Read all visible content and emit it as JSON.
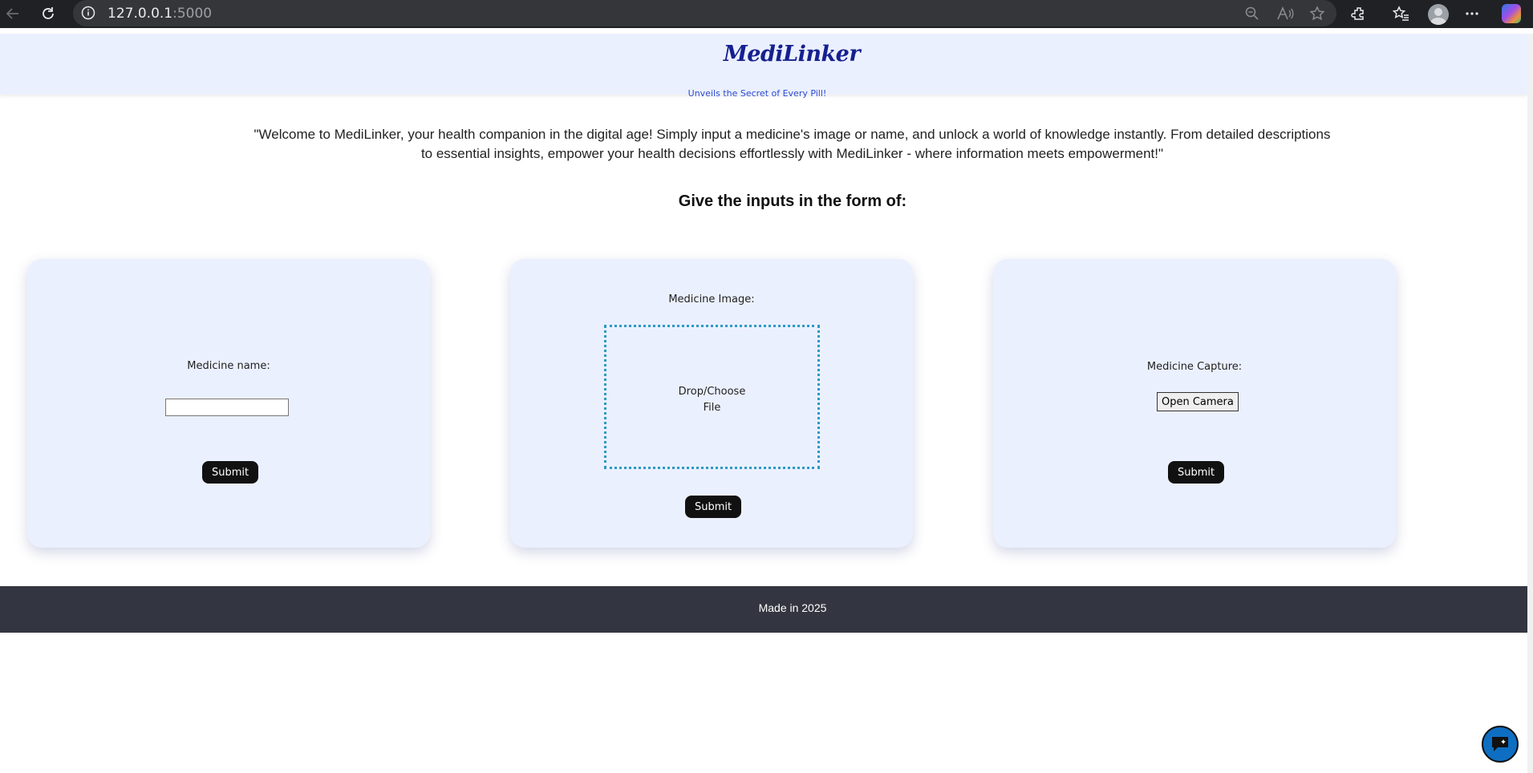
{
  "browser": {
    "url_host": "127.0.0.1",
    "url_port": ":5000"
  },
  "header": {
    "logo": "MediLinker",
    "tagline": "Unveils the Secret of Every Pill!"
  },
  "intro_text": "\"Welcome to MediLinker, your health companion in the digital age! Simply input a medicine's image or name, and unlock a world of knowledge instantly. From detailed descriptions to essential insights, empower your health decisions effortlessly with MediLinker - where information meets empowerment!\"",
  "section_title": "Give the inputs in the form of:",
  "cards": {
    "name": {
      "label": "Medicine name:",
      "input_value": "",
      "submit": "Submit"
    },
    "image": {
      "label": "Medicine Image:",
      "drop_line1": "Drop/Choose",
      "drop_line2": "File",
      "submit": "Submit"
    },
    "capture": {
      "label": "Medicine Capture:",
      "open_camera": "Open Camera",
      "submit": "Submit"
    }
  },
  "footer": {
    "text": "Made in 2025"
  },
  "colors": {
    "accent": "#16208f",
    "card_bg": "#ebf0fe",
    "footer_bg": "#333640",
    "dropzone_border": "#2a9bc4"
  }
}
